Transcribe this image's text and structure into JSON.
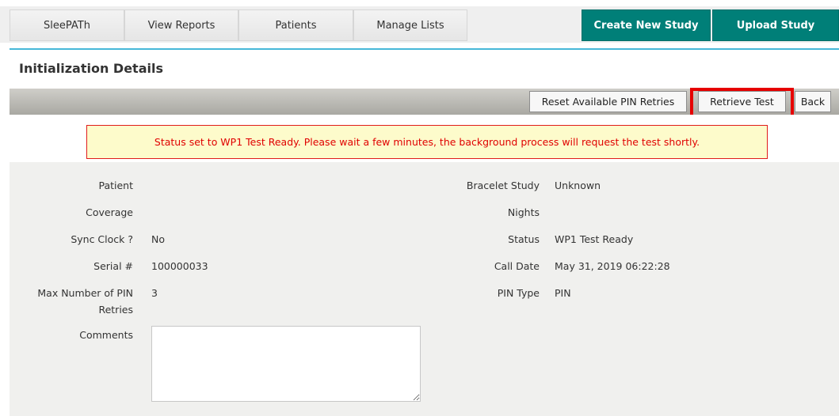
{
  "nav": {
    "tabs": [
      "SleePATh",
      "View Reports",
      "Patients",
      "Manage Lists"
    ],
    "create_label": "Create New Study",
    "upload_label": "Upload Study"
  },
  "page": {
    "title": "Initialization Details"
  },
  "toolbar": {
    "reset_label": "Reset Available PIN Retries",
    "retrieve_label": "Retrieve Test",
    "back_label": "Back"
  },
  "status_message": "Status set to WP1 Test Ready. Please wait a few minutes, the background process will request the test shortly.",
  "fields_left": {
    "patient": {
      "label": "Patient",
      "value": ""
    },
    "coverage": {
      "label": "Coverage",
      "value": ""
    },
    "sync_clock": {
      "label": "Sync Clock ?",
      "value": "No"
    },
    "serial": {
      "label": "Serial #",
      "value": "100000033"
    },
    "max_pin_label_line1": "Max Number of PIN",
    "max_pin_label_line2": "Retries",
    "max_pin_value": "3",
    "comments_label": "Comments",
    "comments_value": ""
  },
  "fields_right": {
    "bracelet_study": {
      "label": "Bracelet Study",
      "value": "Unknown"
    },
    "nights": {
      "label": "Nights",
      "value": ""
    },
    "status": {
      "label": "Status",
      "value": "WP1 Test Ready"
    },
    "call_date": {
      "label": "Call Date",
      "value": "May 31, 2019 06:22:28"
    },
    "pin_type": {
      "label": "PIN Type",
      "value": "PIN"
    }
  },
  "colors": {
    "teal_button": "#007f78",
    "accent_line": "#46b8d8",
    "alert_text": "#e00000",
    "alert_bg": "#fdfbcb",
    "highlight_box": "#e60000"
  }
}
